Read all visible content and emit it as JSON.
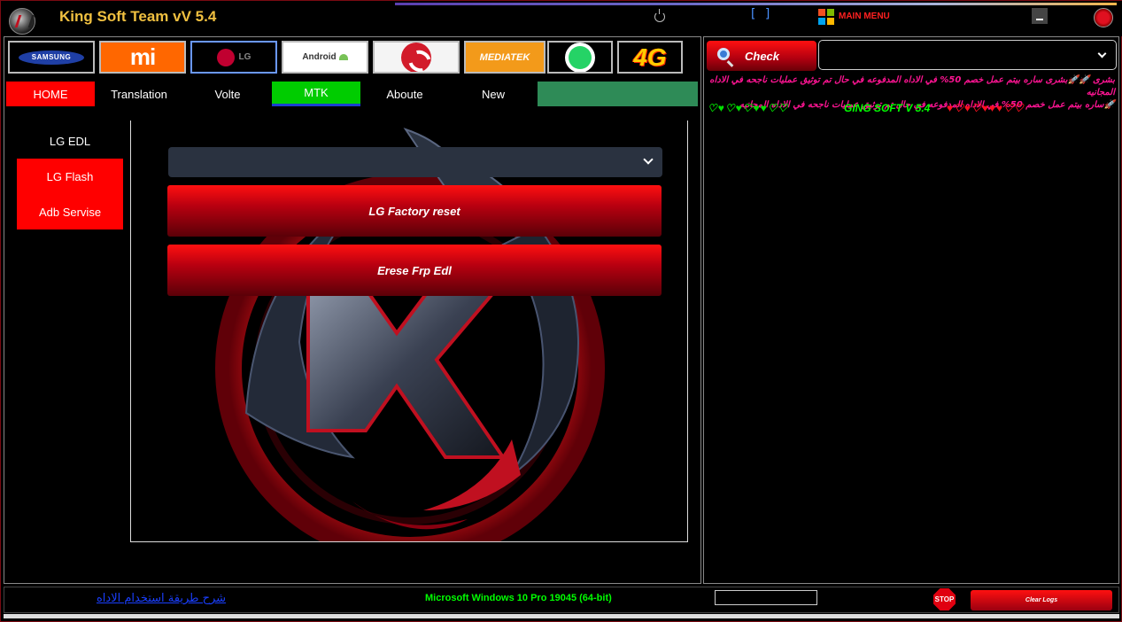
{
  "app": {
    "title": "King Soft Team vV 5.4"
  },
  "titlebar": {
    "power_icon": "power-icon",
    "bracket_text": "[ ]",
    "main_menu_label": "MAIN MENU"
  },
  "brands": {
    "samsung": "SAMSUNG",
    "mi": "mi",
    "lg": "LG",
    "android": "Android",
    "mediatek": "MEDIATEK",
    "four_g": "4G"
  },
  "tabs": [
    "HOME",
    "Translation",
    "Volte",
    "MTK",
    "Aboute",
    "New"
  ],
  "side_menu": [
    "LG EDL",
    "LG Flash",
    "Adb Servise"
  ],
  "work_area": {
    "buttons": [
      "LG Factory reset",
      "Erese Frp Edl"
    ]
  },
  "right_panel": {
    "check_label": "Check",
    "news_line_1": "بشرى 🚀🚀بشرى ساره بيتم عمل خصم 50% في الاداه المدفوعه في حال تم توثيق عمليات ناجحه في الاداه المجانيه",
    "news_line_2": "🚀ساره بيتم عمل خصم 50% في الاداه المدفوعه في حال تم توثيق عمليات ناجحه في الاداه المجانيه",
    "hearts_green": "♡♥♡♥♡♥♥♡♡",
    "brand_line": "GING SOFT V 5.4",
    "hearts_red": "♥♡♥♡♥♥♥♡♡"
  },
  "status_bar": {
    "help_link": "شرح طريقة استخدام الاداه",
    "os_info": "Microsoft Windows 10 Pro 19045 (64-bit)",
    "stop_label": "STOP",
    "clear_logs_label": "Clear Logs"
  },
  "colors": {
    "accent_red": "#ff0000",
    "active_tab_green": "#00cc00",
    "title_gold": "#f0c040"
  }
}
